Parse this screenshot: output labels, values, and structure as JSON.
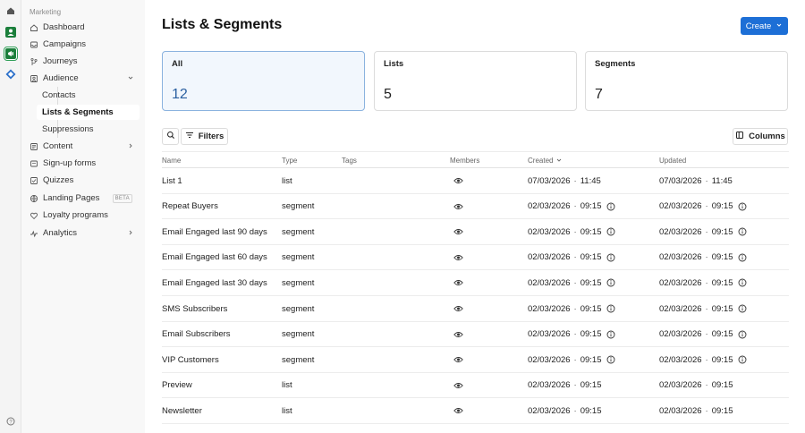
{
  "sidebar": {
    "section_label": "Marketing",
    "items": [
      {
        "label": "Dashboard",
        "icon": "home-icon"
      },
      {
        "label": "Campaigns",
        "icon": "inbox-icon"
      },
      {
        "label": "Journeys",
        "icon": "branch-icon"
      },
      {
        "label": "Audience",
        "icon": "audience-icon"
      },
      {
        "label": "Content",
        "icon": "content-icon"
      },
      {
        "label": "Sign-up forms",
        "icon": "form-icon"
      },
      {
        "label": "Quizzes",
        "icon": "quiz-icon"
      },
      {
        "label": "Landing Pages",
        "icon": "globe-icon",
        "badge": "BETA"
      },
      {
        "label": "Loyalty programs",
        "icon": "heart-icon"
      },
      {
        "label": "Analytics",
        "icon": "analytics-icon"
      }
    ],
    "audience_sub": [
      "Contacts",
      "Lists & Segments",
      "Suppressions"
    ]
  },
  "page": {
    "title": "Lists & Segments",
    "create_label": "Create"
  },
  "cards": [
    {
      "label": "All",
      "count": "12"
    },
    {
      "label": "Lists",
      "count": "5"
    },
    {
      "label": "Segments",
      "count": "7"
    }
  ],
  "toolbar": {
    "filters_label": "Filters",
    "columns_label": "Columns"
  },
  "table": {
    "headers": {
      "name": "Name",
      "type": "Type",
      "tags": "Tags",
      "members": "Members",
      "created": "Created",
      "updated": "Updated"
    },
    "rows": [
      {
        "name": "List 1",
        "type": "list",
        "created_date": "07/03/2026",
        "created_time": "11:45",
        "updated_date": "07/03/2026",
        "updated_time": "11:45",
        "info": false
      },
      {
        "name": "Repeat Buyers",
        "type": "segment",
        "created_date": "02/03/2026",
        "created_time": "09:15",
        "updated_date": "02/03/2026",
        "updated_time": "09:15",
        "info": true
      },
      {
        "name": "Email Engaged last 90 days",
        "type": "segment",
        "created_date": "02/03/2026",
        "created_time": "09:15",
        "updated_date": "02/03/2026",
        "updated_time": "09:15",
        "info": true
      },
      {
        "name": "Email Engaged last 60 days",
        "type": "segment",
        "created_date": "02/03/2026",
        "created_time": "09:15",
        "updated_date": "02/03/2026",
        "updated_time": "09:15",
        "info": true
      },
      {
        "name": "Email Engaged last 30 days",
        "type": "segment",
        "created_date": "02/03/2026",
        "created_time": "09:15",
        "updated_date": "02/03/2026",
        "updated_time": "09:15",
        "info": true
      },
      {
        "name": "SMS Subscribers",
        "type": "segment",
        "created_date": "02/03/2026",
        "created_time": "09:15",
        "updated_date": "02/03/2026",
        "updated_time": "09:15",
        "info": true
      },
      {
        "name": "Email Subscribers",
        "type": "segment",
        "created_date": "02/03/2026",
        "created_time": "09:15",
        "updated_date": "02/03/2026",
        "updated_time": "09:15",
        "info": true
      },
      {
        "name": "VIP Customers",
        "type": "segment",
        "created_date": "02/03/2026",
        "created_time": "09:15",
        "updated_date": "02/03/2026",
        "updated_time": "09:15",
        "info": true
      },
      {
        "name": "Preview",
        "type": "list",
        "created_date": "02/03/2026",
        "created_time": "09:15",
        "updated_date": "02/03/2026",
        "updated_time": "09:15",
        "info": false
      },
      {
        "name": "Newsletter",
        "type": "list",
        "created_date": "02/03/2026",
        "created_time": "09:15",
        "updated_date": "02/03/2026",
        "updated_time": "09:15",
        "info": false
      }
    ]
  },
  "colors": {
    "accent": "#1d6fd6",
    "selected_card_bg": "#f2f7fd"
  }
}
